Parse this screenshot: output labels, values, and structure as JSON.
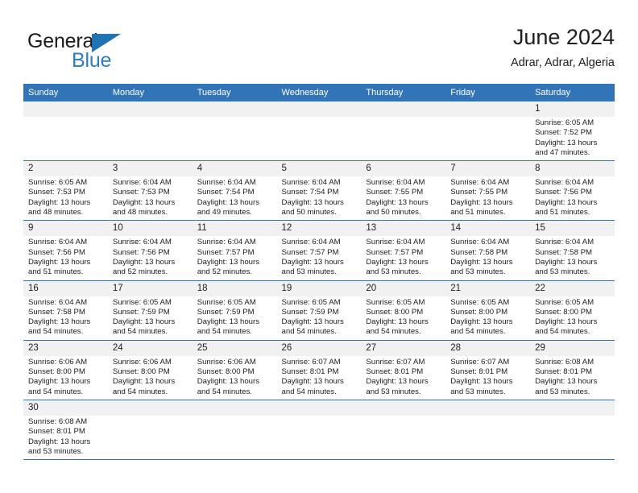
{
  "brand": {
    "name_top": "General",
    "name_bottom": "Blue",
    "accent_color": "#2d7dc4",
    "triangle_color": "#2074b4"
  },
  "header": {
    "title": "June 2024",
    "subtitle": "Adrar, Adrar, Algeria",
    "header_bg": "#3175b8",
    "daynum_bg": "#f1f1f1"
  },
  "weekday_headers": [
    "Sunday",
    "Monday",
    "Tuesday",
    "Wednesday",
    "Thursday",
    "Friday",
    "Saturday"
  ],
  "labels": {
    "sunrise_prefix": "Sunrise:",
    "sunset_prefix": "Sunset:",
    "daylight_prefix": "Daylight:"
  },
  "weeks": [
    [
      {
        "day": "",
        "empty": true
      },
      {
        "day": "",
        "empty": true
      },
      {
        "day": "",
        "empty": true
      },
      {
        "day": "",
        "empty": true
      },
      {
        "day": "",
        "empty": true
      },
      {
        "day": "",
        "empty": true
      },
      {
        "day": "1",
        "sunrise": "Sunrise: 6:05 AM",
        "sunset": "Sunset: 7:52 PM",
        "daylight_1": "Daylight: 13 hours",
        "daylight_2": "and 47 minutes."
      }
    ],
    [
      {
        "day": "2",
        "sunrise": "Sunrise: 6:05 AM",
        "sunset": "Sunset: 7:53 PM",
        "daylight_1": "Daylight: 13 hours",
        "daylight_2": "and 48 minutes."
      },
      {
        "day": "3",
        "sunrise": "Sunrise: 6:04 AM",
        "sunset": "Sunset: 7:53 PM",
        "daylight_1": "Daylight: 13 hours",
        "daylight_2": "and 48 minutes."
      },
      {
        "day": "4",
        "sunrise": "Sunrise: 6:04 AM",
        "sunset": "Sunset: 7:54 PM",
        "daylight_1": "Daylight: 13 hours",
        "daylight_2": "and 49 minutes."
      },
      {
        "day": "5",
        "sunrise": "Sunrise: 6:04 AM",
        "sunset": "Sunset: 7:54 PM",
        "daylight_1": "Daylight: 13 hours",
        "daylight_2": "and 50 minutes."
      },
      {
        "day": "6",
        "sunrise": "Sunrise: 6:04 AM",
        "sunset": "Sunset: 7:55 PM",
        "daylight_1": "Daylight: 13 hours",
        "daylight_2": "and 50 minutes."
      },
      {
        "day": "7",
        "sunrise": "Sunrise: 6:04 AM",
        "sunset": "Sunset: 7:55 PM",
        "daylight_1": "Daylight: 13 hours",
        "daylight_2": "and 51 minutes."
      },
      {
        "day": "8",
        "sunrise": "Sunrise: 6:04 AM",
        "sunset": "Sunset: 7:56 PM",
        "daylight_1": "Daylight: 13 hours",
        "daylight_2": "and 51 minutes."
      }
    ],
    [
      {
        "day": "9",
        "sunrise": "Sunrise: 6:04 AM",
        "sunset": "Sunset: 7:56 PM",
        "daylight_1": "Daylight: 13 hours",
        "daylight_2": "and 51 minutes."
      },
      {
        "day": "10",
        "sunrise": "Sunrise: 6:04 AM",
        "sunset": "Sunset: 7:56 PM",
        "daylight_1": "Daylight: 13 hours",
        "daylight_2": "and 52 minutes."
      },
      {
        "day": "11",
        "sunrise": "Sunrise: 6:04 AM",
        "sunset": "Sunset: 7:57 PM",
        "daylight_1": "Daylight: 13 hours",
        "daylight_2": "and 52 minutes."
      },
      {
        "day": "12",
        "sunrise": "Sunrise: 6:04 AM",
        "sunset": "Sunset: 7:57 PM",
        "daylight_1": "Daylight: 13 hours",
        "daylight_2": "and 53 minutes."
      },
      {
        "day": "13",
        "sunrise": "Sunrise: 6:04 AM",
        "sunset": "Sunset: 7:57 PM",
        "daylight_1": "Daylight: 13 hours",
        "daylight_2": "and 53 minutes."
      },
      {
        "day": "14",
        "sunrise": "Sunrise: 6:04 AM",
        "sunset": "Sunset: 7:58 PM",
        "daylight_1": "Daylight: 13 hours",
        "daylight_2": "and 53 minutes."
      },
      {
        "day": "15",
        "sunrise": "Sunrise: 6:04 AM",
        "sunset": "Sunset: 7:58 PM",
        "daylight_1": "Daylight: 13 hours",
        "daylight_2": "and 53 minutes."
      }
    ],
    [
      {
        "day": "16",
        "sunrise": "Sunrise: 6:04 AM",
        "sunset": "Sunset: 7:58 PM",
        "daylight_1": "Daylight: 13 hours",
        "daylight_2": "and 54 minutes."
      },
      {
        "day": "17",
        "sunrise": "Sunrise: 6:05 AM",
        "sunset": "Sunset: 7:59 PM",
        "daylight_1": "Daylight: 13 hours",
        "daylight_2": "and 54 minutes."
      },
      {
        "day": "18",
        "sunrise": "Sunrise: 6:05 AM",
        "sunset": "Sunset: 7:59 PM",
        "daylight_1": "Daylight: 13 hours",
        "daylight_2": "and 54 minutes."
      },
      {
        "day": "19",
        "sunrise": "Sunrise: 6:05 AM",
        "sunset": "Sunset: 7:59 PM",
        "daylight_1": "Daylight: 13 hours",
        "daylight_2": "and 54 minutes."
      },
      {
        "day": "20",
        "sunrise": "Sunrise: 6:05 AM",
        "sunset": "Sunset: 8:00 PM",
        "daylight_1": "Daylight: 13 hours",
        "daylight_2": "and 54 minutes."
      },
      {
        "day": "21",
        "sunrise": "Sunrise: 6:05 AM",
        "sunset": "Sunset: 8:00 PM",
        "daylight_1": "Daylight: 13 hours",
        "daylight_2": "and 54 minutes."
      },
      {
        "day": "22",
        "sunrise": "Sunrise: 6:05 AM",
        "sunset": "Sunset: 8:00 PM",
        "daylight_1": "Daylight: 13 hours",
        "daylight_2": "and 54 minutes."
      }
    ],
    [
      {
        "day": "23",
        "sunrise": "Sunrise: 6:06 AM",
        "sunset": "Sunset: 8:00 PM",
        "daylight_1": "Daylight: 13 hours",
        "daylight_2": "and 54 minutes."
      },
      {
        "day": "24",
        "sunrise": "Sunrise: 6:06 AM",
        "sunset": "Sunset: 8:00 PM",
        "daylight_1": "Daylight: 13 hours",
        "daylight_2": "and 54 minutes."
      },
      {
        "day": "25",
        "sunrise": "Sunrise: 6:06 AM",
        "sunset": "Sunset: 8:00 PM",
        "daylight_1": "Daylight: 13 hours",
        "daylight_2": "and 54 minutes."
      },
      {
        "day": "26",
        "sunrise": "Sunrise: 6:07 AM",
        "sunset": "Sunset: 8:01 PM",
        "daylight_1": "Daylight: 13 hours",
        "daylight_2": "and 54 minutes."
      },
      {
        "day": "27",
        "sunrise": "Sunrise: 6:07 AM",
        "sunset": "Sunset: 8:01 PM",
        "daylight_1": "Daylight: 13 hours",
        "daylight_2": "and 53 minutes."
      },
      {
        "day": "28",
        "sunrise": "Sunrise: 6:07 AM",
        "sunset": "Sunset: 8:01 PM",
        "daylight_1": "Daylight: 13 hours",
        "daylight_2": "and 53 minutes."
      },
      {
        "day": "29",
        "sunrise": "Sunrise: 6:08 AM",
        "sunset": "Sunset: 8:01 PM",
        "daylight_1": "Daylight: 13 hours",
        "daylight_2": "and 53 minutes."
      }
    ],
    [
      {
        "day": "30",
        "sunrise": "Sunrise: 6:08 AM",
        "sunset": "Sunset: 8:01 PM",
        "daylight_1": "Daylight: 13 hours",
        "daylight_2": "and 53 minutes."
      },
      {
        "day": "",
        "empty": true
      },
      {
        "day": "",
        "empty": true
      },
      {
        "day": "",
        "empty": true
      },
      {
        "day": "",
        "empty": true
      },
      {
        "day": "",
        "empty": true
      },
      {
        "day": "",
        "empty": true
      }
    ]
  ]
}
